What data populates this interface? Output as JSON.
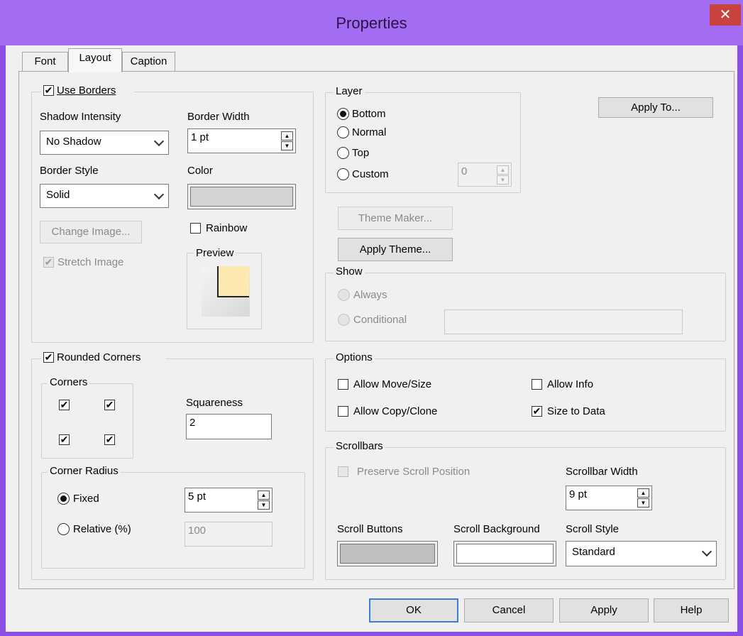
{
  "window": {
    "title": "Properties",
    "close_glyph": "✕"
  },
  "tabs": [
    {
      "label": "Font"
    },
    {
      "label": "Layout",
      "active": true
    },
    {
      "label": "Caption"
    }
  ],
  "borders": {
    "use_borders_label": "Use Borders",
    "use_borders_checked": true,
    "shadow_intensity_label": "Shadow Intensity",
    "shadow_intensity_value": "No Shadow",
    "border_width_label": "Border Width",
    "border_width_value": "1 pt",
    "border_style_label": "Border Style",
    "border_style_value": "Solid",
    "color_label": "Color",
    "color_value": "#d4d4d4",
    "change_image_label": "Change Image...",
    "rainbow_label": "Rainbow",
    "stretch_image_label": "Stretch Image",
    "preview_label": "Preview"
  },
  "layer": {
    "label": "Layer",
    "options": [
      "Bottom",
      "Normal",
      "Top",
      "Custom"
    ],
    "selected": "Bottom",
    "custom_value": "0"
  },
  "buttons": {
    "apply_to": "Apply To...",
    "theme_maker": "Theme Maker...",
    "apply_theme": "Apply Theme..."
  },
  "show": {
    "label": "Show",
    "always_label": "Always",
    "conditional_label": "Conditional"
  },
  "rounded": {
    "label": "Rounded Corners",
    "checked": true,
    "corners_label": "Corners",
    "squareness_label": "Squareness",
    "squareness_value": "2",
    "corner_radius_label": "Corner Radius",
    "fixed_label": "Fixed",
    "fixed_value": "5 pt",
    "relative_label": "Relative (%)",
    "relative_value": "100"
  },
  "options": {
    "label": "Options",
    "allow_move_size": "Allow Move/Size",
    "allow_info": "Allow Info",
    "allow_copy_clone": "Allow Copy/Clone",
    "size_to_data": "Size to Data"
  },
  "scrollbars": {
    "label": "Scrollbars",
    "preserve_label": "Preserve Scroll Position",
    "width_label": "Scrollbar Width",
    "width_value": "9 pt",
    "buttons_label": "Scroll Buttons",
    "buttons_color": "#c0c0c0",
    "background_label": "Scroll Background",
    "background_color": "#ffffff",
    "style_label": "Scroll Style",
    "style_value": "Standard"
  },
  "footer": {
    "ok": "OK",
    "cancel": "Cancel",
    "apply": "Apply",
    "help": "Help"
  },
  "check_glyph": "✔"
}
